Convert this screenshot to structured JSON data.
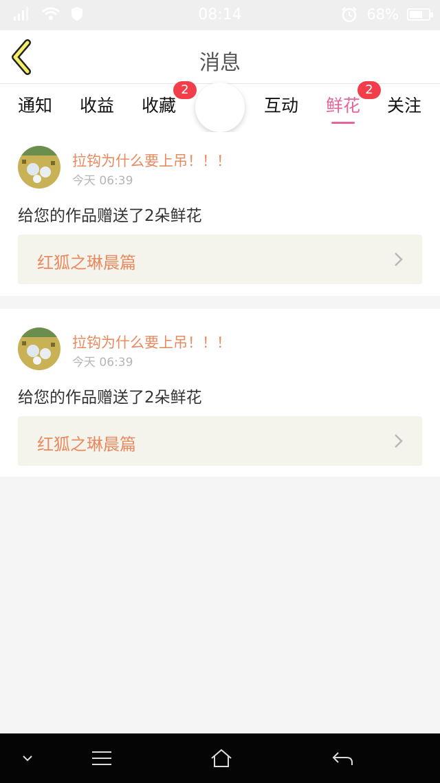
{
  "status": {
    "time": "08:14",
    "battery": "68%",
    "battery_level": 0.68,
    "icons": [
      "signal-icon",
      "wifi-icon",
      "shield-icon",
      "alarm-icon",
      "battery-icon"
    ]
  },
  "header": {
    "title": "消息",
    "back_icon": "back-arrow-icon"
  },
  "tabs": [
    {
      "label": "通知",
      "badge": ""
    },
    {
      "label": "收益",
      "badge": ""
    },
    {
      "label": "收藏",
      "badge": "2"
    },
    {
      "label": "互动",
      "badge": ""
    },
    {
      "label": "鲜花",
      "badge": "2",
      "active": true
    },
    {
      "label": "关注",
      "badge": ""
    }
  ],
  "colors": {
    "accent": "#e5649c",
    "orange_text": "#e98a5e",
    "badge": "#f23e4a",
    "link_bg": "#f4f3ec"
  },
  "notifications": [
    {
      "username": "拉钩为什么要上吊！！！",
      "time": "今天 06:39",
      "message": "给您的作品赠送了2朵鲜花",
      "work_title": "红狐之琳晨篇"
    },
    {
      "username": "拉钩为什么要上吊！！！",
      "time": "今天 06:39",
      "message": "给您的作品赠送了2朵鲜花",
      "work_title": "红狐之琳晨篇"
    }
  ],
  "navbar": {
    "icons": [
      "chevron-down-icon",
      "menu-icon",
      "home-icon",
      "back-icon"
    ]
  }
}
